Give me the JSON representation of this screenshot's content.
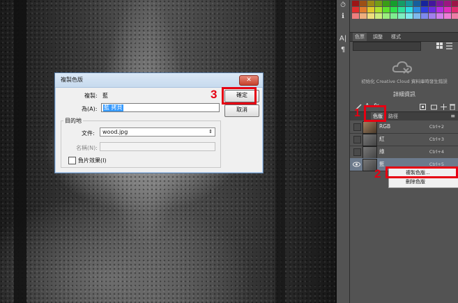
{
  "dialog": {
    "title": "複製色版",
    "close_glyph": "✕",
    "duplicate_label": "複製:",
    "duplicate_value": "藍",
    "as_label": "為(A):",
    "as_value": "藍 拷貝",
    "ok_label": "確定",
    "cancel_label": "取消",
    "destination_label": "目的地",
    "document_label": "文件:",
    "document_value": "wood.jpg",
    "name_label": "名稱(N):",
    "name_value": "",
    "invert_label": "負片效果(I)"
  },
  "panel": {
    "tabs": [
      {
        "label": "色票"
      },
      {
        "label": "調整"
      },
      {
        "label": "樣式"
      }
    ],
    "cc_message": "初始化 Creative Cloud 資料庫時發生錯誤",
    "section_title": "詳細資訊",
    "channel_tabs": [
      {
        "label": "色版"
      },
      {
        "label": "路徑"
      }
    ],
    "channels": [
      {
        "name": "RGB",
        "shortcut": "Ctrl+2"
      },
      {
        "name": "紅",
        "shortcut": "Ctrl+3"
      },
      {
        "name": "綠",
        "shortcut": "Ctrl+4"
      },
      {
        "name": "藍",
        "shortcut": "Ctrl+5"
      }
    ]
  },
  "context_menu": {
    "items": [
      {
        "label": "複製色版..."
      },
      {
        "label": "刪除色版"
      }
    ]
  },
  "annotations": {
    "step1": "1",
    "step2": "2",
    "step3": "3",
    "color": "#e60012"
  },
  "toolstrip": {
    "icons": [
      "history-icon",
      "info-icon",
      "character-icon",
      "paragraph-icon"
    ],
    "glyphs": [
      "⏱",
      "ℹ",
      "A|",
      "¶"
    ]
  },
  "colors": {
    "panel_bg": "#535353",
    "selected_channel": "#6c7a8c",
    "dialog_bg": "#f0f0f0",
    "selection_blue": "#3399ff"
  }
}
